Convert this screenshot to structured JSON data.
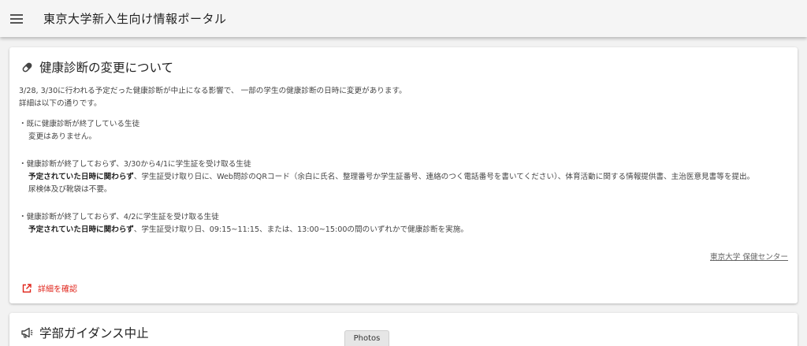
{
  "header": {
    "title": "東京大学新入生向け情報ポータル",
    "menu_icon": "hamburger-menu-icon"
  },
  "cards": [
    {
      "title": "健康診断の変更について",
      "icon": "pill-icon",
      "lines": {
        "intro1": "3/28, 3/30に行われる予定だった健康診断が中止になる影響で、 一部の学生の健康診断の日時に変更があります。",
        "intro2": "詳細は以下の通りです。",
        "case1_head": "・既に健康診断が終了している生徒",
        "case1_body": "変更はありません。",
        "case2_head": "・健康診断が終了しておらず、3/30から4/1に学生証を受け取る生徒",
        "case2_bold": "予定されていた日時に関わらず",
        "case2_rest": "、学生証受け取り日に、Web問診のQRコード（余白に氏名、整理番号か学生証番号、連絡のつく電話番号を書いてください）、体育活動に関する情報提供書、主治医意見書等を提出。",
        "case2_note": "尿検体及び靴袋は不要。",
        "case3_head": "・健康診断が終了しておらず、4/2に学生証を受け取る生徒",
        "case3_bold": "予定されていた日時に関わらず",
        "case3_rest": "、学生証受け取り日、09:15~11:15、または、13:00~15:00の間のいずれかで健康診断を実施。"
      },
      "source": "東京大学 保健センター",
      "detail_link": "詳細を確認",
      "detail_icon": "open-in-new-icon"
    },
    {
      "title": "学部ガイダンス中止",
      "icon": "megaphone-icon"
    }
  ],
  "overlay": {
    "photos_tab": "Photos"
  },
  "colors": {
    "accent": "#e0261c",
    "background": "#f2f2f2",
    "card": "#ffffff"
  }
}
